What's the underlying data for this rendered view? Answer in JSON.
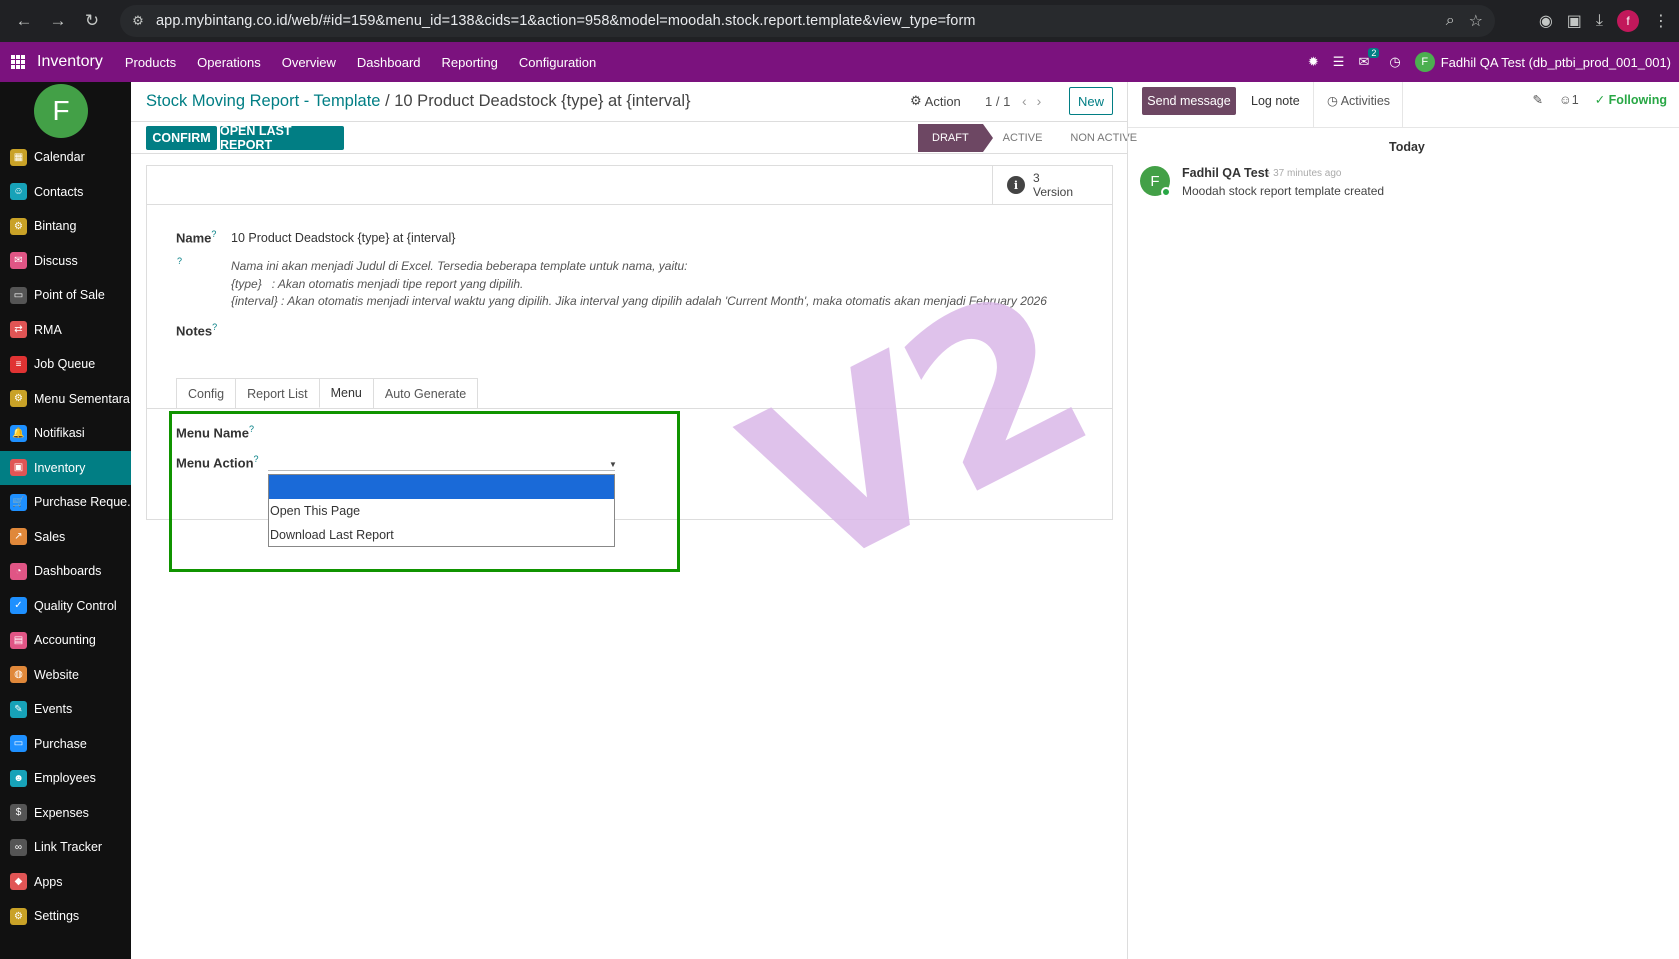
{
  "browser": {
    "url": "app.mybintang.co.id/web/#id=159&menu_id=138&cids=1&action=958&model=moodah.stock.report.template&view_type=form",
    "profile_initial": "f"
  },
  "topbar": {
    "brand": "Inventory",
    "menu": [
      "Products",
      "Operations",
      "Overview",
      "Dashboard",
      "Reporting",
      "Configuration"
    ],
    "chat_count": "2",
    "user_initial": "F",
    "user_label": "Fadhil QA Test (db_ptbi_prod_001_001)"
  },
  "sidebar": {
    "avatar_initial": "F",
    "items": [
      {
        "label": "Calendar",
        "color": "#c9a227",
        "glyph": "▦"
      },
      {
        "label": "Contacts",
        "color": "#17a2b8",
        "glyph": "☺"
      },
      {
        "label": "Bintang",
        "color": "#c9a227",
        "glyph": "⚙"
      },
      {
        "label": "Discuss",
        "color": "#e05585",
        "glyph": "✉"
      },
      {
        "label": "Point of Sale",
        "color": "#555555",
        "glyph": "▭"
      },
      {
        "label": "RMA",
        "color": "#e05555",
        "glyph": "⇄"
      },
      {
        "label": "Job Queue",
        "color": "#e03333",
        "glyph": "≡"
      },
      {
        "label": "Menu Sementara",
        "color": "#c9a227",
        "glyph": "⚙"
      },
      {
        "label": "Notifikasi",
        "color": "#1e90ff",
        "glyph": "🔔"
      },
      {
        "label": "Inventory",
        "color": "#e05555",
        "glyph": "▣"
      },
      {
        "label": "Purchase Reque...",
        "color": "#1e90ff",
        "glyph": "🛒"
      },
      {
        "label": "Sales",
        "color": "#e0883a",
        "glyph": "↗"
      },
      {
        "label": "Dashboards",
        "color": "#e05585",
        "glyph": "◔"
      },
      {
        "label": "Quality Control",
        "color": "#1e90ff",
        "glyph": "✓"
      },
      {
        "label": "Accounting",
        "color": "#e05585",
        "glyph": "▤"
      },
      {
        "label": "Website",
        "color": "#e0883a",
        "glyph": "◍"
      },
      {
        "label": "Events",
        "color": "#17a2b8",
        "glyph": "✎"
      },
      {
        "label": "Purchase",
        "color": "#1e90ff",
        "glyph": "▭"
      },
      {
        "label": "Employees",
        "color": "#17a2b8",
        "glyph": "☻"
      },
      {
        "label": "Expenses",
        "color": "#555555",
        "glyph": "$"
      },
      {
        "label": "Link Tracker",
        "color": "#555555",
        "glyph": "∞"
      },
      {
        "label": "Apps",
        "color": "#e05555",
        "glyph": "◆"
      },
      {
        "label": "Settings",
        "color": "#c9a227",
        "glyph": "⚙"
      }
    ]
  },
  "control": {
    "breadcrumb_parent": "Stock Moving Report - Template",
    "breadcrumb_sep": "/",
    "breadcrumb_current": "10 Product Deadstock {type} at {interval}",
    "action_label": "Action",
    "pager": "1 / 1",
    "new_label": "New",
    "confirm_label": "CONFIRM",
    "open_last_label": "OPEN LAST REPORT",
    "statuses": [
      "DRAFT",
      "ACTIVE",
      "NON ACTIVE"
    ]
  },
  "form": {
    "version_count": "3",
    "version_label": "Version",
    "name_label": "Name",
    "name_value": "10 Product Deadstock {type} at {interval}",
    "help_lines": [
      "Nama ini akan menjadi Judul di Excel. Tersedia beberapa template untuk nama, yaitu:",
      "{type}   : Akan otomatis menjadi tipe report yang dipilih.",
      "{interval} : Akan otomatis menjadi interval waktu yang dipilih. Jika interval yang dipilih adalah 'Current Month', maka otomatis akan menjadi February 2026"
    ],
    "notes_label": "Notes",
    "tabs": [
      "Config",
      "Report List",
      "Menu",
      "Auto Generate"
    ],
    "menu_name_label": "Menu Name",
    "menu_action_label": "Menu Action",
    "menu_action_options": [
      "",
      "Open This Page",
      "Download Last Report"
    ]
  },
  "watermark": "V2",
  "chatter": {
    "send_label": "Send message",
    "log_label": "Log note",
    "activities_label": "Activities",
    "followers_count": "1",
    "following_label": "Following",
    "today_label": "Today",
    "author_initial": "F",
    "author": "Fadhil QA Test",
    "time": "- 37 minutes ago",
    "body": "Moodah stock report template created"
  }
}
